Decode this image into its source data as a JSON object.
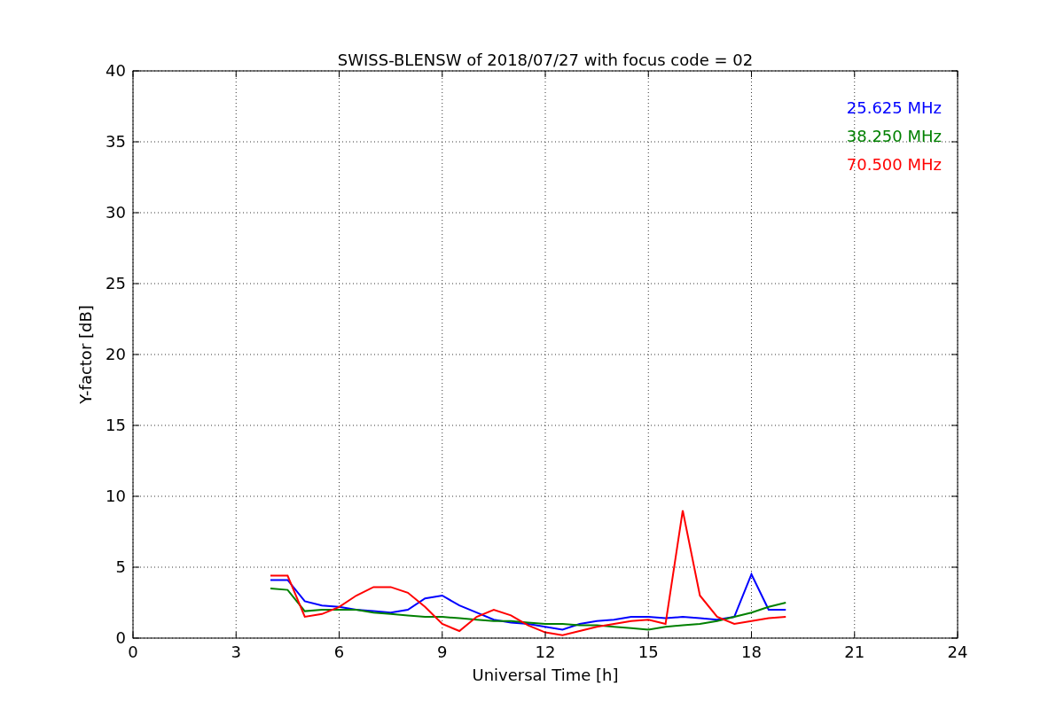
{
  "chart_data": {
    "type": "line",
    "title": "SWISS-BLENSW of 2018/07/27 with focus code = 02",
    "xlabel": "Universal Time [h]",
    "ylabel": "Y-factor [dB]",
    "x": [
      4,
      4.5,
      5,
      5.5,
      6,
      6.5,
      7,
      7.5,
      8,
      8.5,
      9,
      9.5,
      10,
      10.5,
      11,
      11.5,
      12,
      12.5,
      13,
      13.5,
      14,
      14.5,
      15,
      15.5,
      16,
      16.5,
      17,
      17.5,
      18,
      18.5,
      19
    ],
    "series": [
      {
        "name": "25.625 MHz",
        "color": "#0000ff",
        "values": [
          4.1,
          4.1,
          2.6,
          2.3,
          2.2,
          2.0,
          1.9,
          1.8,
          2.0,
          2.8,
          3.0,
          2.3,
          1.8,
          1.3,
          1.1,
          1.0,
          0.8,
          0.6,
          1.0,
          1.2,
          1.3,
          1.5,
          1.5,
          1.4,
          1.5,
          1.4,
          1.3,
          1.5,
          4.5,
          2.0,
          2.0
        ]
      },
      {
        "name": "38.250 MHz",
        "color": "#008000",
        "values": [
          3.5,
          3.4,
          1.9,
          2.0,
          2.0,
          2.0,
          1.8,
          1.7,
          1.6,
          1.5,
          1.5,
          1.4,
          1.3,
          1.2,
          1.2,
          1.1,
          1.0,
          1.0,
          0.9,
          0.9,
          0.8,
          0.7,
          0.6,
          0.8,
          0.9,
          1.0,
          1.2,
          1.5,
          1.8,
          2.2,
          2.5
        ]
      },
      {
        "name": "70.500 MHz",
        "color": "#ff0000",
        "values": [
          4.4,
          4.4,
          1.5,
          1.7,
          2.2,
          3.0,
          3.6,
          3.6,
          3.2,
          2.2,
          1.0,
          0.5,
          1.5,
          2.0,
          1.6,
          0.9,
          0.4,
          0.2,
          0.5,
          0.8,
          1.0,
          1.2,
          1.3,
          1.0,
          9.0,
          3.0,
          1.5,
          1.0,
          1.2,
          1.4,
          1.5
        ]
      }
    ],
    "grid": true,
    "xlim": [
      0,
      24
    ],
    "ylim": [
      0,
      40
    ],
    "xticks": [
      0,
      3,
      6,
      9,
      12,
      15,
      18,
      21,
      24
    ],
    "yticks": [
      0,
      5,
      10,
      15,
      20,
      25,
      30,
      35,
      40
    ]
  }
}
